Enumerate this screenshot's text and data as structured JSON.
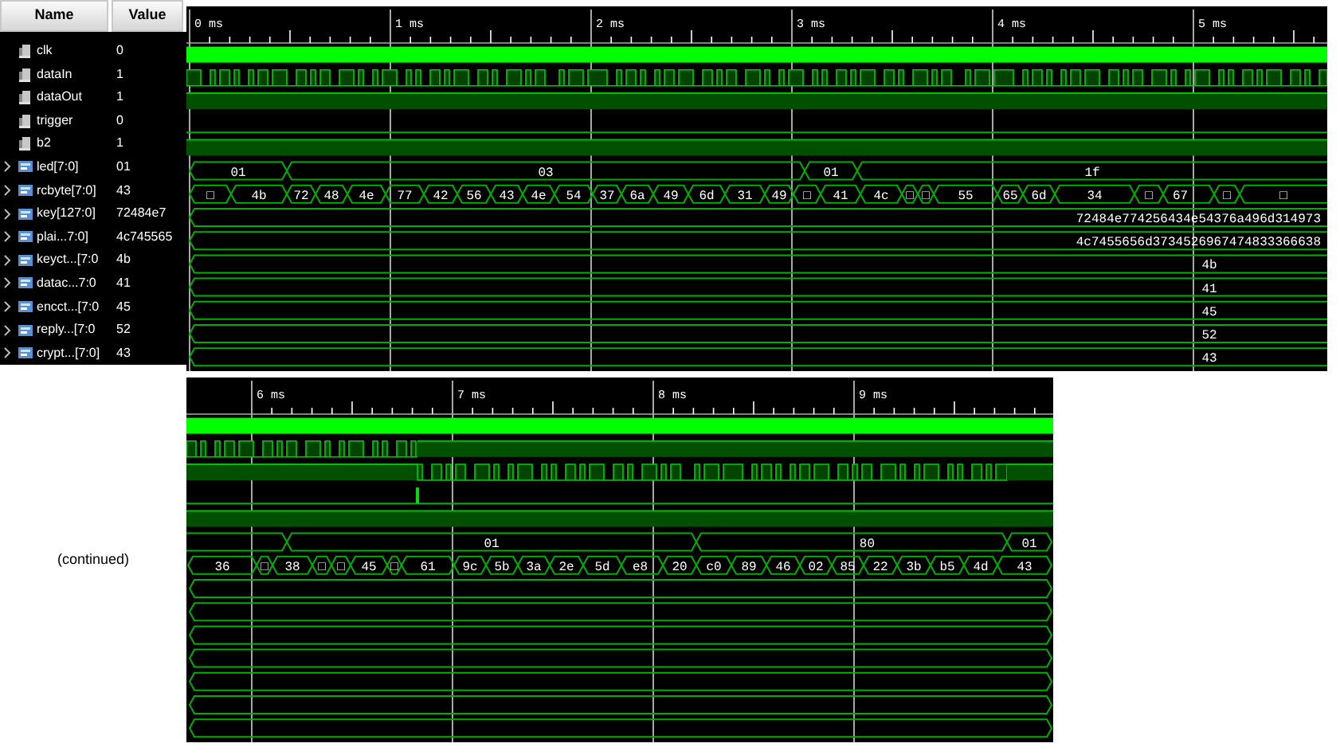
{
  "headers": [
    "Name",
    "Value"
  ],
  "signals": [
    {
      "name": "clk",
      "value": "0",
      "kind": "bit"
    },
    {
      "name": "dataIn",
      "value": "1",
      "kind": "bit"
    },
    {
      "name": "dataOut",
      "value": "1",
      "kind": "bit"
    },
    {
      "name": "trigger",
      "value": "0",
      "kind": "bit"
    },
    {
      "name": "b2",
      "value": "1",
      "kind": "bit"
    },
    {
      "name": "led[7:0]",
      "value": "01",
      "kind": "bus",
      "expanded": false
    },
    {
      "name": "rcbyte[7:0]",
      "value": "43",
      "kind": "bus",
      "expanded": false
    },
    {
      "name": "key[127:0]",
      "value": "72484e7",
      "kind": "bus",
      "expanded": false
    },
    {
      "name": "plai...7:0]",
      "value": "4c745565",
      "kind": "bus",
      "expanded": false
    },
    {
      "name": "keyct...[7:0",
      "value": "4b",
      "kind": "bus",
      "expanded": false
    },
    {
      "name": "datac...7:0",
      "value": "41",
      "kind": "bus",
      "expanded": false
    },
    {
      "name": "encct...[7:0",
      "value": "45",
      "kind": "bus",
      "expanded": false
    },
    {
      "name": "reply...[7:0",
      "value": "52",
      "kind": "bus",
      "expanded": false
    },
    {
      "name": "crypt...[7:0]",
      "value": "43",
      "kind": "bus",
      "expanded": false
    }
  ],
  "views": [
    {
      "ticks": [
        "0 ms",
        "1 ms",
        "2 ms",
        "3 ms",
        "4 ms",
        "5 ms"
      ],
      "traces": [
        {
          "kind": "clock"
        },
        {
          "kind": "pulses"
        },
        {
          "kind": "high"
        },
        {
          "kind": "low"
        },
        {
          "kind": "high"
        },
        {
          "kind": "bus",
          "segments": [
            "01",
            "03",
            "01",
            "1f"
          ]
        },
        {
          "kind": "bus",
          "segments": [
            "□",
            "4b",
            "72",
            "48",
            "4e",
            "77",
            "42",
            "56",
            "43",
            "4e",
            "54",
            "37",
            "6a",
            "49",
            "6d",
            "31",
            "49",
            "□",
            "41",
            "4c",
            "□",
            "□",
            "55",
            "65",
            "6d",
            "34",
            "□",
            "67",
            "□",
            "□"
          ]
        },
        {
          "kind": "bus",
          "segments": [
            "72484e774256434e54376a496d314973"
          ]
        },
        {
          "kind": "bus",
          "segments": [
            "4c7455656d3734526967474833366638"
          ]
        },
        {
          "kind": "bus",
          "segments": [
            "4b"
          ]
        },
        {
          "kind": "bus",
          "segments": [
            "41"
          ]
        },
        {
          "kind": "bus",
          "segments": [
            "45"
          ]
        },
        {
          "kind": "bus",
          "segments": [
            "52"
          ]
        },
        {
          "kind": "bus",
          "segments": [
            "43"
          ]
        }
      ]
    },
    {
      "caption": "(continued)",
      "ticks": [
        "6 ms",
        "7 ms",
        "8 ms",
        "9 ms"
      ],
      "traces": [
        {
          "kind": "clock"
        },
        {
          "kind": "pulses_then_high"
        },
        {
          "kind": "high_then_pulses"
        },
        {
          "kind": "low_with_spike"
        },
        {
          "kind": "high"
        },
        {
          "kind": "bus",
          "segments": [
            "01",
            "80",
            "01"
          ]
        },
        {
          "kind": "bus",
          "segments": [
            "36",
            "□",
            "38",
            "□",
            "□",
            "45",
            "□",
            "61",
            "9c",
            "5b",
            "3a",
            "2e",
            "5d",
            "e8",
            "20",
            "c0",
            "89",
            "46",
            "02",
            "85",
            "22",
            "3b",
            "b5",
            "4d",
            "43"
          ]
        },
        {
          "kind": "bus"
        },
        {
          "kind": "bus"
        },
        {
          "kind": "bus"
        },
        {
          "kind": "bus"
        },
        {
          "kind": "bus"
        },
        {
          "kind": "bus"
        },
        {
          "kind": "bus"
        }
      ]
    }
  ]
}
